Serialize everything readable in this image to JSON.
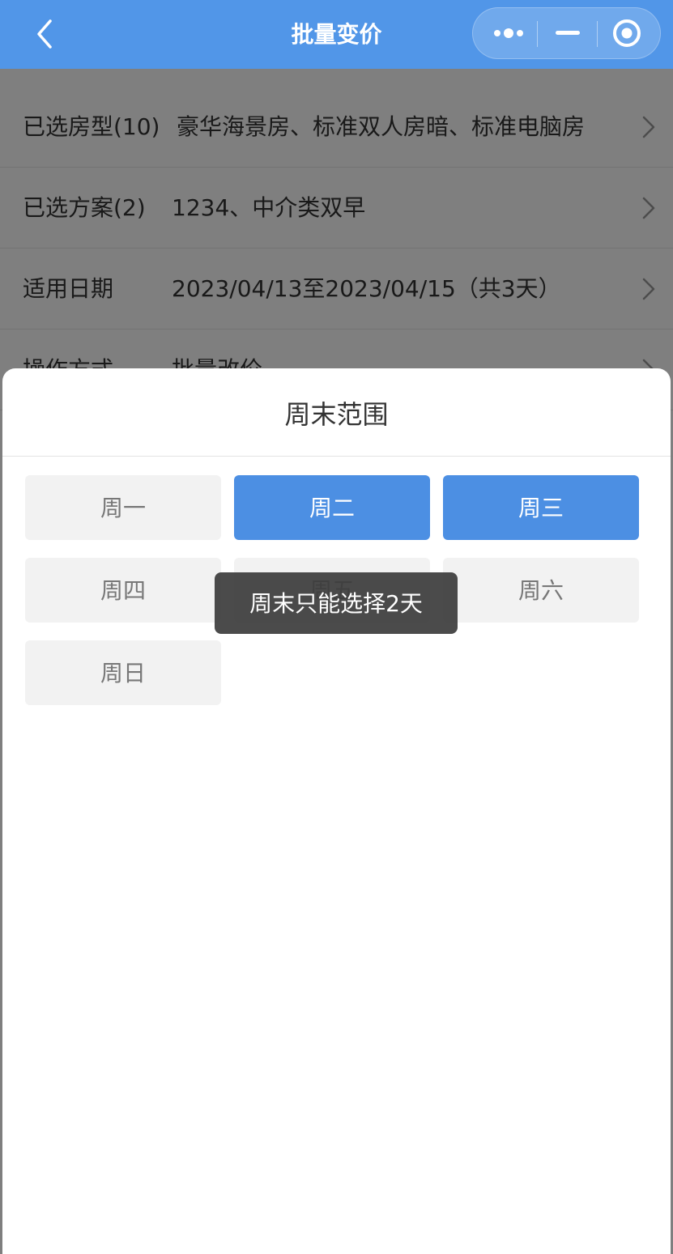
{
  "navbar": {
    "title": "批量变价",
    "back_icon": "chevron-left-icon",
    "capsule": {
      "more_icon": "more-dots-icon",
      "minimize_icon": "minimize-icon",
      "close_icon": "target-circle-icon"
    }
  },
  "form": {
    "rows": [
      {
        "label": "已选房型(10)",
        "value": "豪华海景房、标准双人房暗、标准电脑房"
      },
      {
        "label": "已选方案(2)",
        "value": "1234、中介类双早"
      },
      {
        "label": "适用日期",
        "value": "2023/04/13至2023/04/15（共3天）"
      },
      {
        "label": "操作方式",
        "value": "批量改价"
      }
    ]
  },
  "sheet": {
    "title": "周末范围",
    "days": [
      {
        "label": "周一",
        "selected": false
      },
      {
        "label": "周二",
        "selected": true
      },
      {
        "label": "周三",
        "selected": true
      },
      {
        "label": "周四",
        "selected": false
      },
      {
        "label": "周五",
        "selected": false
      },
      {
        "label": "周六",
        "selected": false
      },
      {
        "label": "周日",
        "selected": false
      }
    ]
  },
  "toast": {
    "text": "周末只能选择2天"
  },
  "colors": {
    "navbar_bg": "#5196e8",
    "selected_bg": "#4c8fe3",
    "unselected_bg": "#f2f2f2",
    "unselected_text": "#777777"
  }
}
